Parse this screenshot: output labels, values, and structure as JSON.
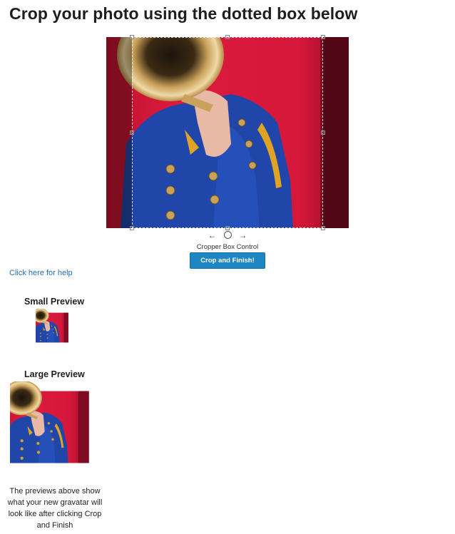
{
  "page": {
    "title": "Crop your photo using the dotted box below"
  },
  "cropper": {
    "arrow_left": "←",
    "arrow_right": "→",
    "control_label": "Cropper Box Control",
    "crop_button_label": "Crop and Finish!"
  },
  "help": {
    "link_text": "Click here for help"
  },
  "previews": {
    "small_title": "Small Preview",
    "large_title": "Large Preview",
    "note": "The previews above show what your new gravatar will look like after clicking Crop and Finish"
  },
  "colors": {
    "background_red": "#d8183a",
    "jacket_blue": "#1f46a8",
    "button_blue": "#1e87c3",
    "link_blue": "#1f6fb2"
  }
}
